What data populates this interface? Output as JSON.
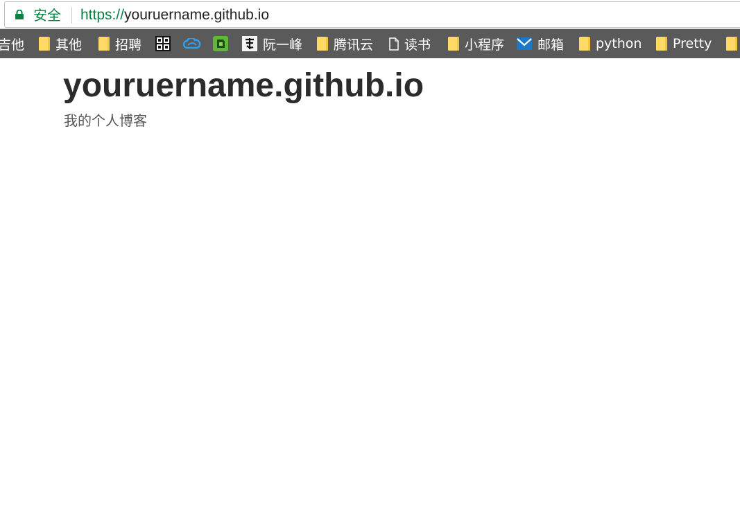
{
  "address_bar": {
    "security_label": "安全",
    "url_scheme": "https://",
    "url_host": "youruername.github.io"
  },
  "bookmarks": [
    {
      "label": "吉他",
      "icon": "folder-icon"
    },
    {
      "label": "其他",
      "icon": "folder-icon"
    },
    {
      "label": "招聘",
      "icon": "folder-icon"
    },
    {
      "label": "",
      "icon": "code-site-icon"
    },
    {
      "label": "",
      "icon": "cloud-icon"
    },
    {
      "label": "",
      "icon": "evernote-icon"
    },
    {
      "label": "阮一峰",
      "icon": "calligraphy-icon"
    },
    {
      "label": "腾讯云",
      "icon": "folder-icon"
    },
    {
      "label": "读书",
      "icon": "page-icon"
    },
    {
      "label": "小程序",
      "icon": "folder-icon"
    },
    {
      "label": "邮箱",
      "icon": "mail-icon"
    },
    {
      "label": "python",
      "icon": "folder-icon"
    },
    {
      "label": "Pretty",
      "icon": "folder-icon"
    },
    {
      "label": "",
      "icon": "folder-icon"
    }
  ],
  "page": {
    "title": "youruername.github.io",
    "subtitle": "我的个人博客"
  },
  "colors": {
    "secure_green": "#0b8043",
    "bookmarks_bar": "#5a5a5a",
    "folder_yellow": "#ffd966",
    "title_text": "#2b2b2b"
  }
}
